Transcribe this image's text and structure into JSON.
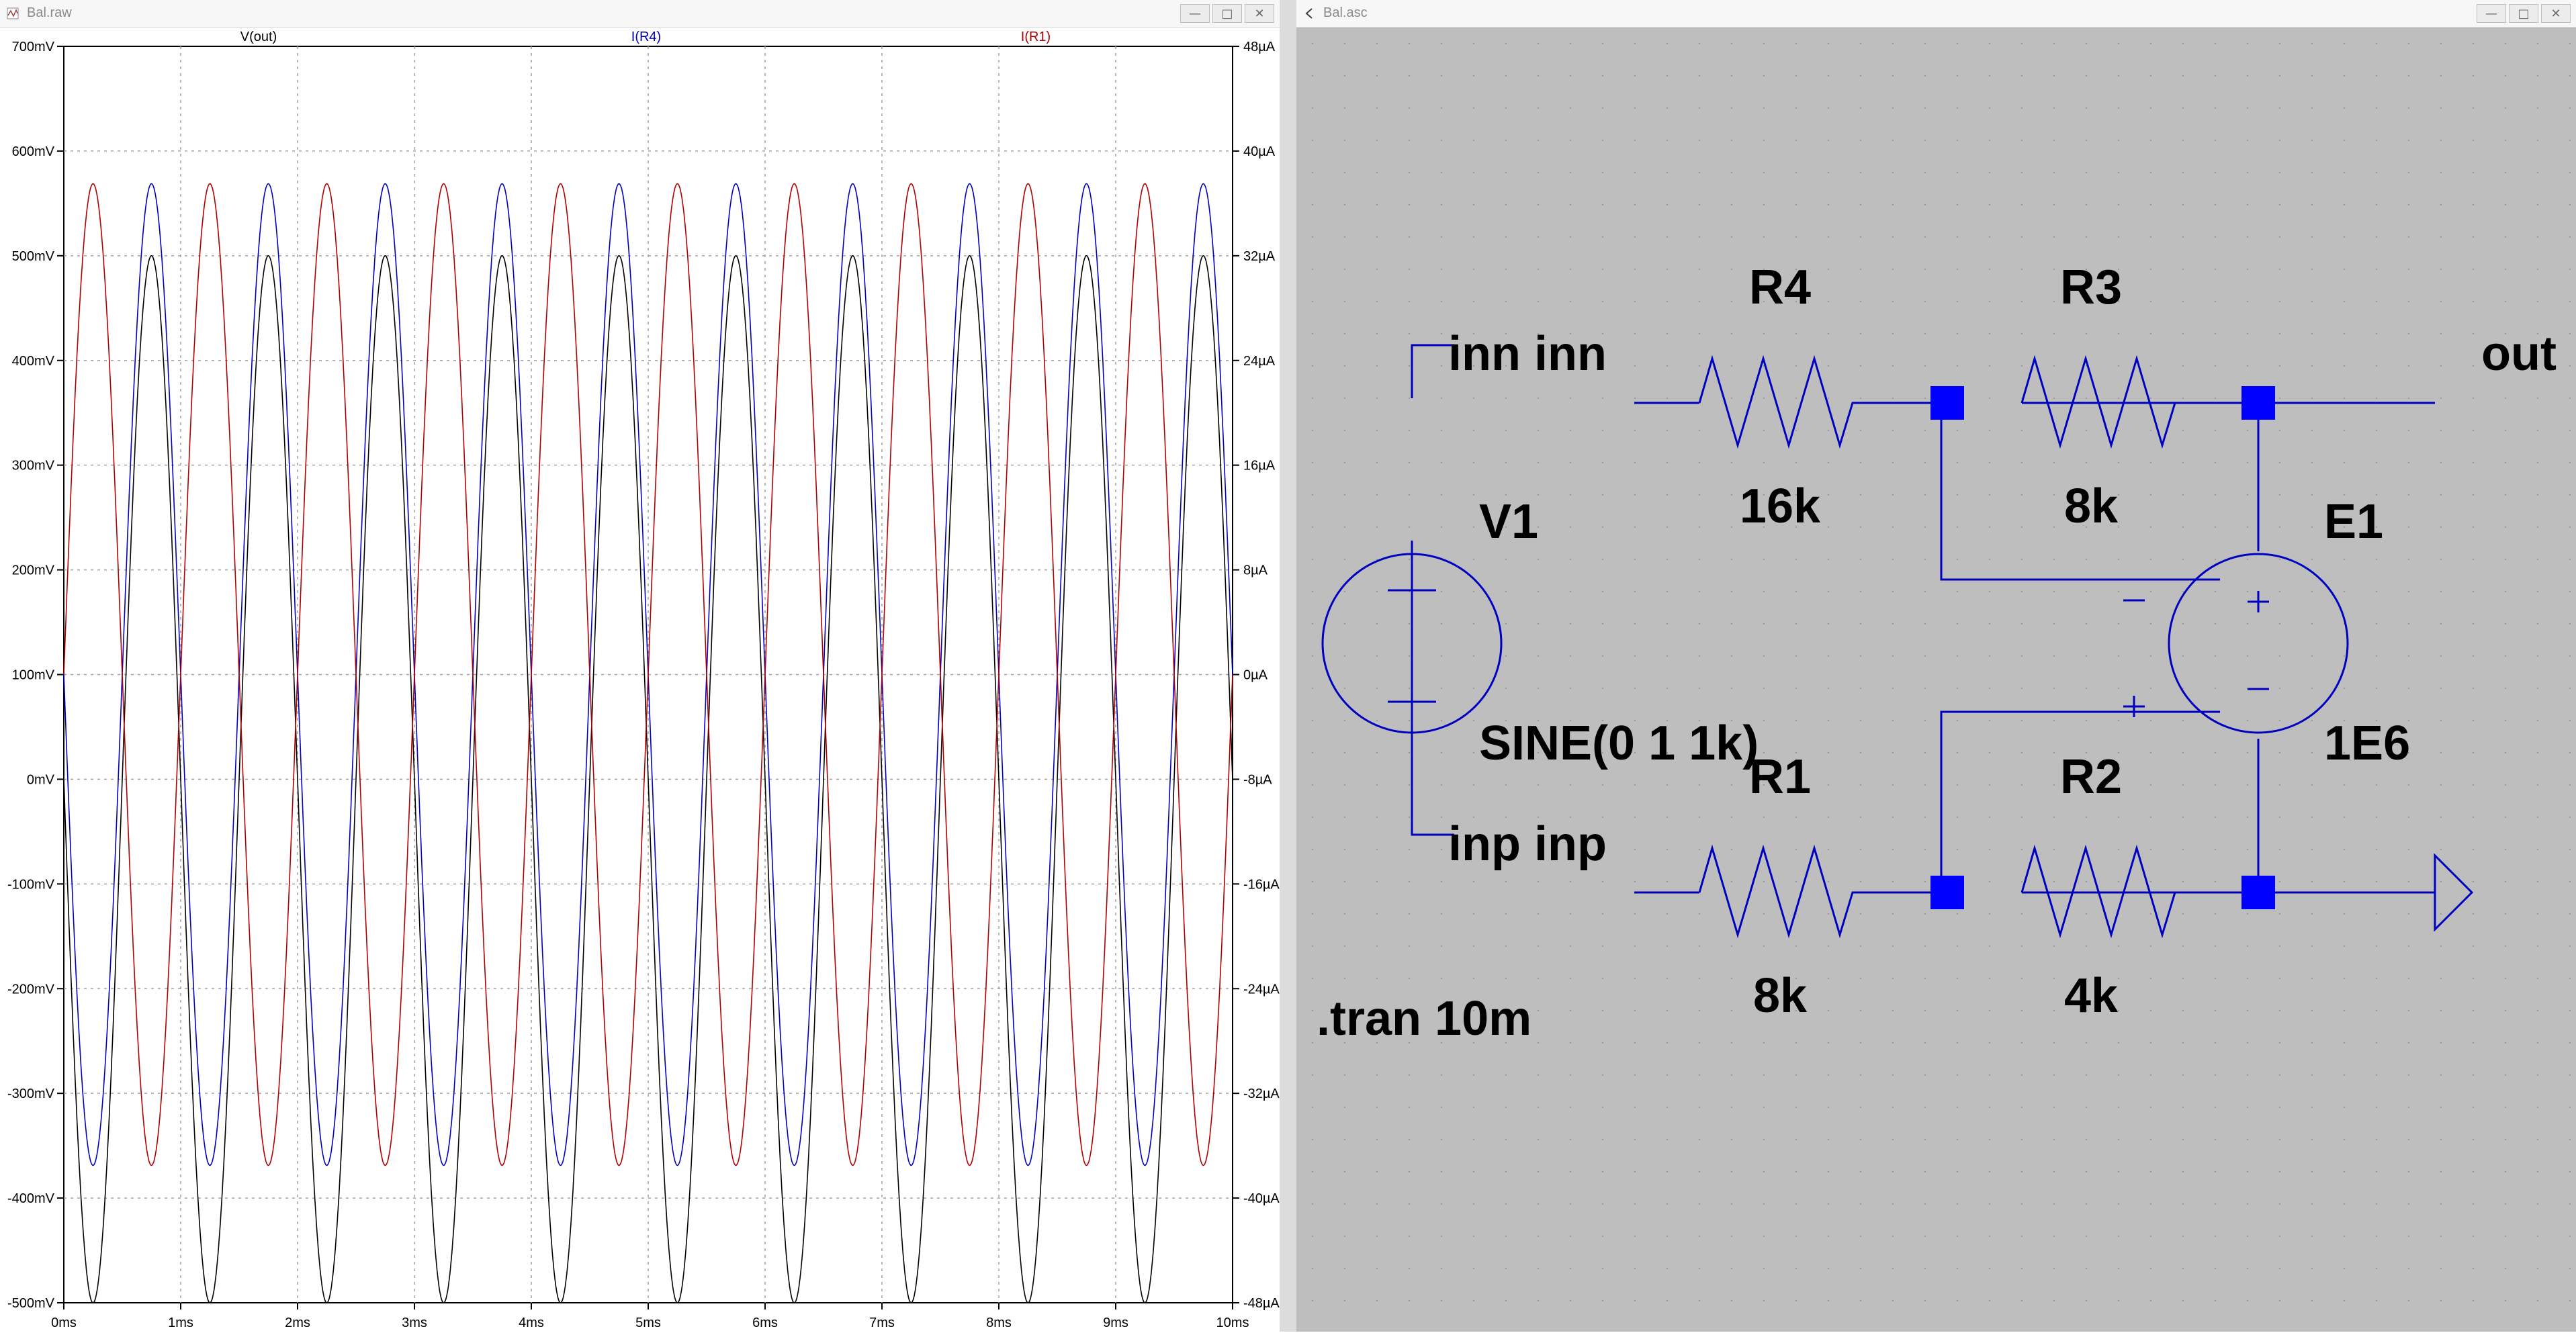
{
  "plot_window": {
    "title": "Bal.raw",
    "buttons": [
      "—",
      "□",
      "✕"
    ]
  },
  "schematic_window": {
    "title": "Bal.asc",
    "buttons": [
      "—",
      "□",
      "✕"
    ]
  },
  "chart_data": {
    "type": "line",
    "traces": [
      {
        "name": "V(out)",
        "color": "#000000",
        "axis": "left",
        "amplitude_mV": 500,
        "offset_mV": 0,
        "freq_kHz": 1,
        "phase": "inverted"
      },
      {
        "name": "I(R4)",
        "color": "#0000c0",
        "axis": "right",
        "amplitude_uA": 37.5,
        "offset_uA": 0,
        "freq_kHz": 1,
        "phase": "inverted"
      },
      {
        "name": "I(R1)",
        "color": "#b00000",
        "axis": "right",
        "amplitude_uA": 37.5,
        "offset_uA": 0,
        "freq_kHz": 1,
        "phase": "normal"
      }
    ],
    "x_ticks": [
      "0ms",
      "1ms",
      "2ms",
      "3ms",
      "4ms",
      "5ms",
      "6ms",
      "7ms",
      "8ms",
      "9ms",
      "10ms"
    ],
    "y_left_ticks": [
      "700mV",
      "600mV",
      "500mV",
      "400mV",
      "300mV",
      "200mV",
      "100mV",
      "0mV",
      "-100mV",
      "-200mV",
      "-300mV",
      "-400mV",
      "-500mV"
    ],
    "y_right_ticks": [
      "48µA",
      "40µA",
      "32µA",
      "24µA",
      "16µA",
      "8µA",
      "0µA",
      "-8µA",
      "-16µA",
      "-24µA",
      "-32µA",
      "-40µA",
      "-48µA"
    ],
    "xlim": [
      0,
      10
    ],
    "ylim_left_mV": [
      -500,
      700
    ],
    "ylim_right_uA": [
      -48,
      48
    ],
    "grid": true
  },
  "schematic": {
    "labels": {
      "r4_name": "R4",
      "r4_value": "16k",
      "r3_name": "R3",
      "r3_value": "8k",
      "r1_name": "R1",
      "r1_value": "8k",
      "r2_name": "R2",
      "r2_value": "4k",
      "v1_name": "V1",
      "v1_value": "SINE(0 1 1k)",
      "e1_name": "E1",
      "e1_value": "1E6",
      "net_inn": "inn inn",
      "net_inp": "inp inp",
      "net_out": "out",
      "directive": ".tran 10m"
    },
    "colors": {
      "wire": "#0000c0",
      "junction": "#0000ff",
      "background": "#bebebe",
      "text": "#000000"
    }
  }
}
